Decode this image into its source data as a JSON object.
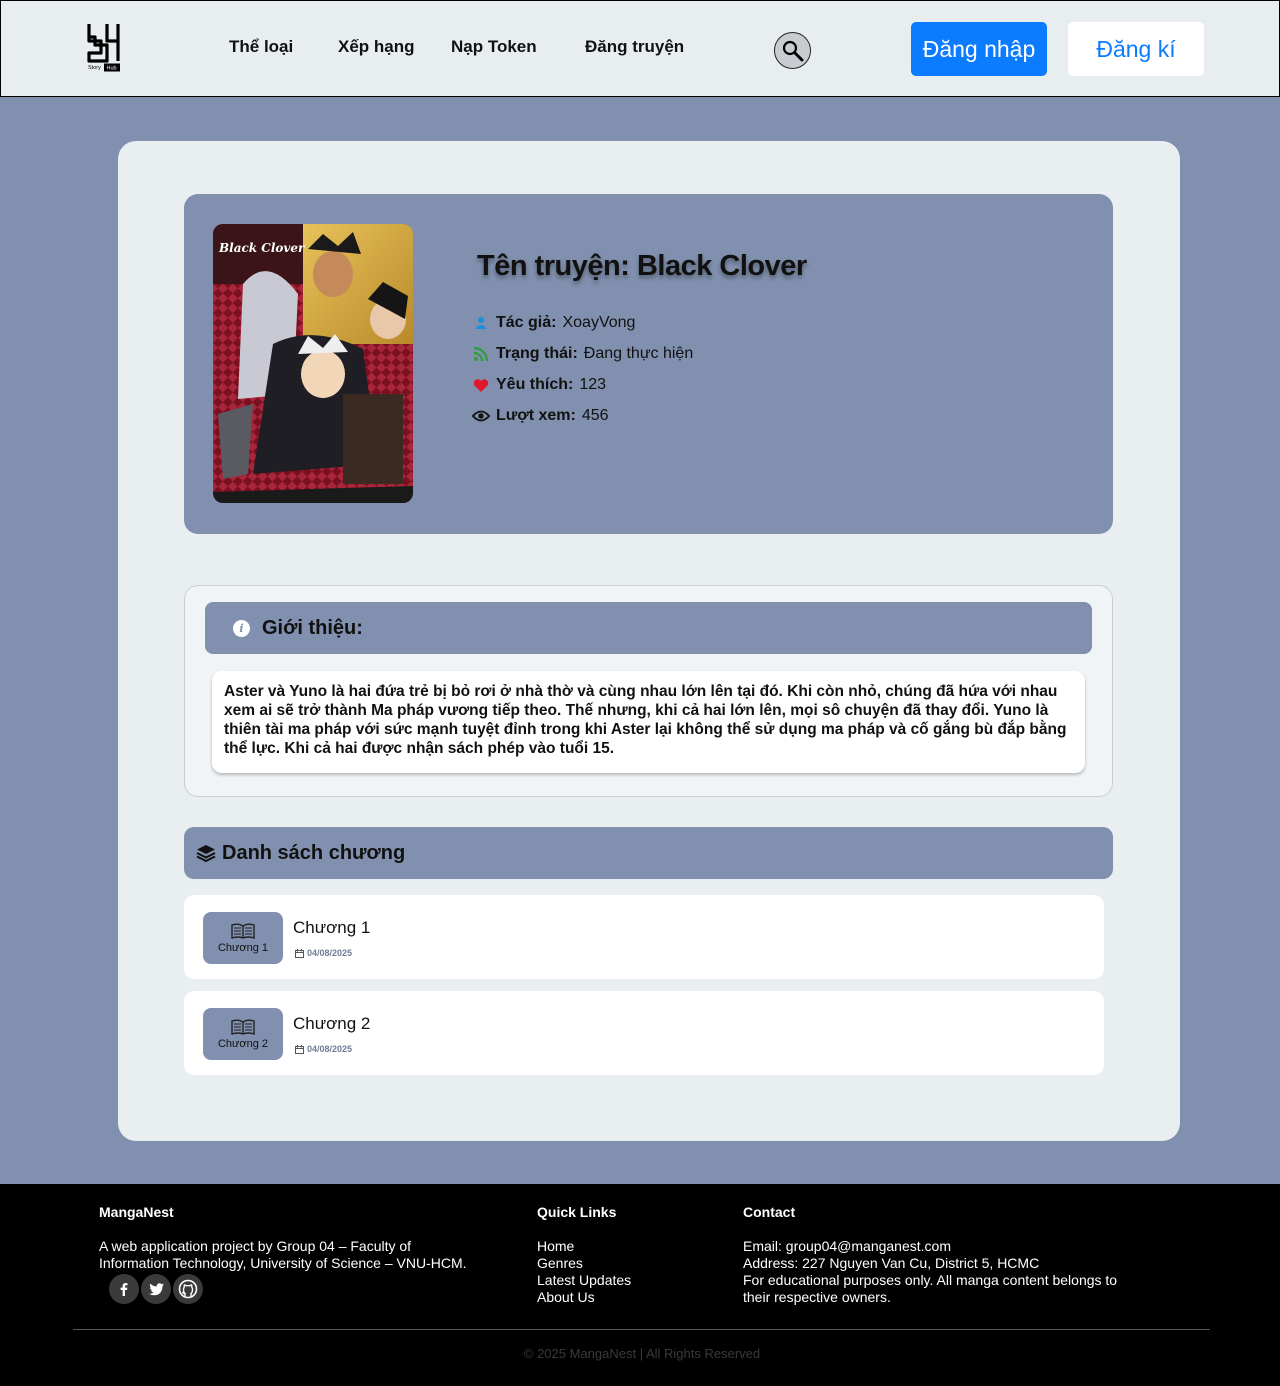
{
  "header": {
    "logo": {
      "icon": "storyhub-logo-icon",
      "text_top": "Story",
      "text_badge": "Hub"
    },
    "nav": [
      "Thể loại",
      "Xếp hạng",
      "Nạp Token",
      "Đăng truyện"
    ],
    "search_icon": "search-icon",
    "login_label": "Đăng nhập",
    "register_label": "Đăng kí"
  },
  "story": {
    "title": "Tên truyện: Black Clover",
    "cover_logo_text": "Black Clover",
    "author_label": "Tác giả:",
    "author": "XoayVong",
    "status_label": "Trạng thái:",
    "status": "Đang thực hiện",
    "likes_label": "Yêu thích:",
    "likes": "123",
    "views_label": "Lượt xem:",
    "views": "456"
  },
  "intro": {
    "heading": "Giới thiệu:",
    "text": "Aster và Yuno là hai đứa trẻ bị bỏ rơi ở nhà thờ và cùng nhau lớn lên tại đó. Khi còn nhỏ, chúng đã hứa với nhau xem ai sẽ trở thành Ma pháp vương tiếp theo. Thế nhưng, khi cả hai lớn lên, mọi sô chuyện đã thay đổi. Yuno là thiên tài ma pháp với sức mạnh tuyệt đỉnh trong khi Aster lại không thể sử dụng ma pháp và cố gắng bù đắp bằng thể lực. Khi cả hai được nhận sách phép vào tuổi 15."
  },
  "chapters": {
    "heading": "Danh sách chương",
    "items": [
      {
        "badge": "Chương 1",
        "title": "Chương 1",
        "date": "04/08/2025"
      },
      {
        "badge": "Chương 2",
        "title": "Chương 2",
        "date": "04/08/2025"
      }
    ]
  },
  "footer": {
    "brand": "MangaNest",
    "description_line1": "A web application project by Group 04 – Faculty of",
    "description_line2": "Information Technology, University of Science – VNU-HCM.",
    "quick_links_title": "Quick Links",
    "quick_links": [
      "Home",
      "Genres",
      "Latest Updates",
      "About Us"
    ],
    "contact_title": "Contact",
    "email": "Email: group04@manganest.com",
    "address": "Address: 227 Nguyen Van Cu, District 5, HCMC",
    "notice_line1": "For educational purposes only. All manga content belongs to",
    "notice_line2": "their respective owners.",
    "social": [
      "facebook-icon",
      "twitter-icon",
      "github-icon"
    ],
    "copyright": "© 2025 MangaNest | All Rights Reserved"
  },
  "colors": {
    "page_bg": "#8090AE",
    "header_bg": "#E8EEF0",
    "card_bg": "#E9EEF0",
    "accent_blue": "#0B7BFF",
    "heart_red": "#E0182D",
    "rss_green": "#2E9E3A",
    "footer_bg": "#000000"
  }
}
